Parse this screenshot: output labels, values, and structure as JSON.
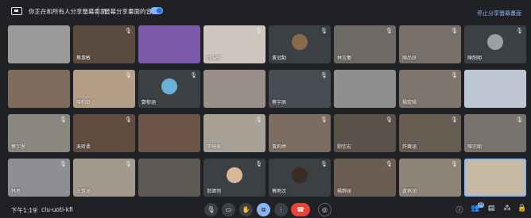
{
  "topbar": {
    "share_status": "你正在和所有人分享螢幕畫面",
    "audio_toggle_label": "螢幕分享畫面的音效",
    "stop_sharing": "停止分享螢幕畫面"
  },
  "tiles": [
    {
      "name": "",
      "bg": "#9a9a98",
      "mic": "",
      "avatar": ""
    },
    {
      "name": "蔡惠敏",
      "bg": "#5b4a3e",
      "mic": "🎙",
      "avatar": ""
    },
    {
      "name": "",
      "bg": "#7a5aa8",
      "mic": "",
      "avatar": ""
    },
    {
      "name": "姚瑞彤",
      "bg": "#cfc7bd",
      "mic": "🎙",
      "avatar": ""
    },
    {
      "name": "黃冠勳",
      "bg": "#3c4043",
      "mic": "🎙",
      "avatar": "#8a6a4a"
    },
    {
      "name": "林宜蓁",
      "bg": "#6d6a66",
      "mic": "🎙",
      "avatar": ""
    },
    {
      "name": "陳品妍",
      "bg": "#77706a",
      "mic": "🎙",
      "avatar": ""
    },
    {
      "name": "陳韶翔",
      "bg": "#3c4043",
      "mic": "🎙",
      "avatar": "#9aa0a6"
    },
    {
      "name": "",
      "bg": "#806c5e",
      "mic": "",
      "avatar": ""
    },
    {
      "name": "陳柏諺",
      "bg": "#b59e88",
      "mic": "🎙",
      "avatar": ""
    },
    {
      "name": "鄭郁涵",
      "bg": "#3c4043",
      "mic": "🎙",
      "avatar": "#6ab0d8"
    },
    {
      "name": "",
      "bg": "#9a8e88",
      "mic": "",
      "avatar": ""
    },
    {
      "name": "蔡宇辰",
      "bg": "#4a4c55",
      "mic": "🎙",
      "avatar": ""
    },
    {
      "name": "",
      "bg": "#8f8f8f",
      "mic": "",
      "avatar": ""
    },
    {
      "name": "楊鎧陽",
      "bg": "#7f756c",
      "mic": "🎙",
      "avatar": ""
    },
    {
      "name": "",
      "bg": "#bcc7d3",
      "mic": "",
      "avatar": ""
    },
    {
      "name": "蔡宇恩",
      "bg": "#8a8680",
      "mic": "🎙",
      "avatar": ""
    },
    {
      "name": "吳昕柔",
      "bg": "#5e4c3e",
      "mic": "🎙",
      "avatar": ""
    },
    {
      "name": "",
      "bg": "#6b5648",
      "mic": "",
      "avatar": ""
    },
    {
      "name": "李曉華",
      "bg": "#a8a296",
      "mic": "🎙",
      "avatar": ""
    },
    {
      "name": "黃莉婷",
      "bg": "#7b6e60",
      "mic": "🎙",
      "avatar": ""
    },
    {
      "name": "劉信宏",
      "bg": "#5a5248",
      "mic": "🎙",
      "avatar": ""
    },
    {
      "name": "許樂涵",
      "bg": "#665c52",
      "mic": "🎙",
      "avatar": ""
    },
    {
      "name": "陳宗翰",
      "bg": "#77746f",
      "mic": "🎙",
      "avatar": ""
    },
    {
      "name": "林思",
      "bg": "#8e8f92",
      "mic": "🎙",
      "avatar": ""
    },
    {
      "name": "王筑涵",
      "bg": "#a4998d",
      "mic": "🎙",
      "avatar": ""
    },
    {
      "name": "",
      "bg": "#5f5a55",
      "mic": "",
      "avatar": ""
    },
    {
      "name": "翁瑋翎",
      "bg": "#3c4043",
      "mic": "🎙",
      "avatar": "#d9b89a"
    },
    {
      "name": "蔡雨汶",
      "bg": "#3c4043",
      "mic": "🎙",
      "avatar": "#3a2c22"
    },
    {
      "name": "楊靜涵",
      "bg": "#6a5e52",
      "mic": "🎙",
      "avatar": ""
    },
    {
      "name": "盧佩涵",
      "bg": "#8d8376",
      "mic": "🎙",
      "avatar": ""
    },
    {
      "name": "",
      "bg": "#c7b9a4",
      "mic": "",
      "avatar": ""
    }
  ],
  "bottombar": {
    "time": "下午1:19",
    "meeting_code": "clu-uoti-kfi",
    "participant_count": "33"
  },
  "controls": {
    "mic": "🎙",
    "camera": "▭",
    "hand": "✋",
    "present": "⧉",
    "more": "⋮",
    "end": "☎",
    "record": "◎"
  },
  "right_icons": {
    "info": "ⓘ",
    "people": "👥",
    "chat": "▤",
    "activities": "⁂",
    "lock": "🔒"
  },
  "colors": {
    "accent": "#8ab4f8",
    "end_call": "#ea4335",
    "background": "#202124"
  }
}
